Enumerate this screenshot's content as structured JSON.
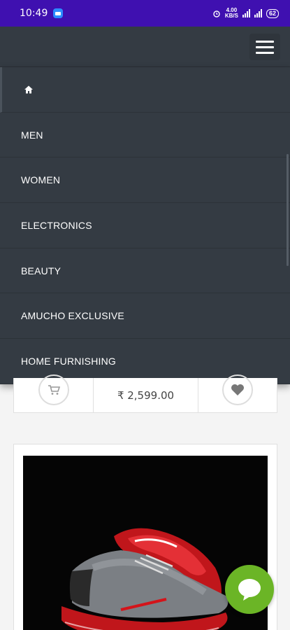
{
  "status_bar": {
    "time": "10:49",
    "speed_value": "4.00",
    "speed_unit": "KB/S",
    "battery": "62"
  },
  "header": {
    "menu_icon": "hamburger-icon"
  },
  "nav": {
    "home_icon": "home-icon",
    "items": [
      {
        "label": "MEN"
      },
      {
        "label": "WOMEN"
      },
      {
        "label": "ELECTRONICS"
      },
      {
        "label": "BEAUTY"
      },
      {
        "label": "AMUCHO EXCLUSIVE"
      },
      {
        "label": "HOME FURNISHING"
      }
    ]
  },
  "product_card": {
    "price": "₹ 2,599.00",
    "cart_icon": "cart-icon",
    "wishlist_icon": "heart-icon"
  },
  "product_card_2": {
    "image": "red-grey-sneaker-image"
  },
  "chat": {
    "icon": "chat-bubble-icon",
    "color": "#6bb526"
  }
}
